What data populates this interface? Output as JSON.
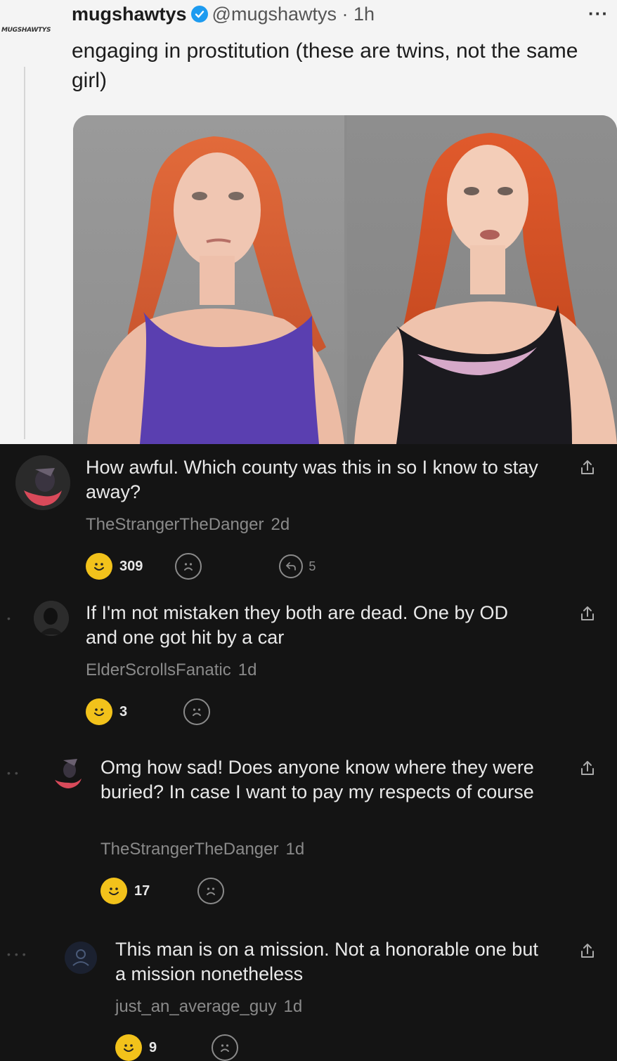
{
  "tweet": {
    "account_label": "MUGSHAWTYS",
    "display_name": "mugshawtys",
    "handle_time": "@mugshawtys · 1h",
    "text": "engaging in prostitution (these are twins, not the same girl)"
  },
  "comments": [
    {
      "text": "How awful. Which county was this in so I know to stay away?",
      "author": "TheStrangerTheDanger",
      "time": "2d",
      "likes": "309",
      "replies": "5"
    },
    {
      "text": "If I'm not mistaken they both are dead. One by OD and one got hit by a car",
      "author": "ElderScrollsFanatic",
      "time": "1d",
      "likes": "3"
    },
    {
      "text": "Omg how sad! Does anyone know where they were buried? In case I want to pay my respects of course",
      "author": "TheStrangerTheDanger",
      "time": "1d",
      "likes": "17"
    },
    {
      "text": "This man is on a mission. Not a honorable one but a mission nonetheless",
      "author": "just_an_average_guy",
      "time": "1d",
      "likes": "9"
    }
  ],
  "colors": {
    "tweet_bg": "#f4f4f4",
    "comments_bg": "#141414",
    "reaction_yellow": "#f2c21b",
    "verified_blue": "#1d9bf0"
  }
}
